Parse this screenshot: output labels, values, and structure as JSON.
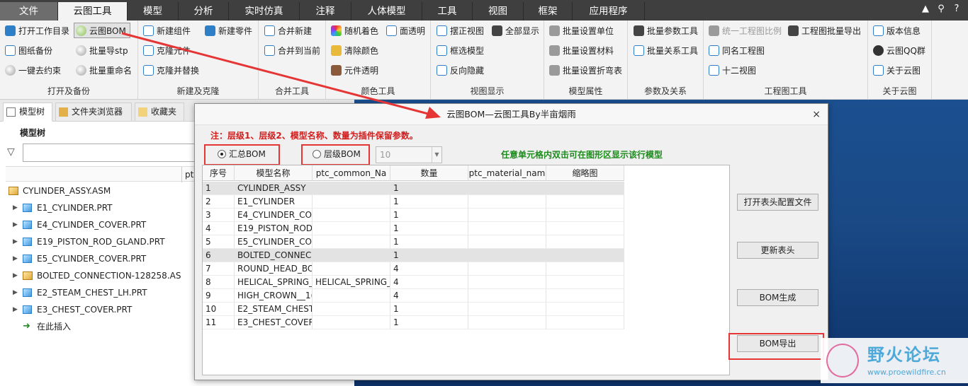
{
  "menu": {
    "tabs": [
      "文件",
      "云图工具",
      "模型",
      "分析",
      "实时仿真",
      "注释",
      "人体模型",
      "工具",
      "视图",
      "框架",
      "应用程序"
    ],
    "active": "云图工具",
    "right_icons": [
      "expand-up-icon",
      "search-icon",
      "help-icon"
    ]
  },
  "ribbon": {
    "groups": [
      {
        "title": "打开及备份",
        "items": [
          "打开工作目录",
          "云图BOM",
          "图纸备份",
          "批量导stp",
          "一键去约束",
          "批量重命名"
        ]
      },
      {
        "title": "新建及克隆",
        "items": [
          "新建组件",
          "新建零件",
          "克隆元件",
          "克隆并替换"
        ]
      },
      {
        "title": "合并工具",
        "items": [
          "合并新建",
          "合并到当前"
        ]
      },
      {
        "title": "颜色工具",
        "items": [
          "随机着色",
          "面透明",
          "清除颜色",
          "元件透明"
        ]
      },
      {
        "title": "视图显示",
        "items": [
          "摆正视图",
          "全部显示",
          "框选模型",
          "反向隐藏"
        ]
      },
      {
        "title": "模型属性",
        "items": [
          "批量设置单位",
          "批量设置材料",
          "批量设置折弯表"
        ]
      },
      {
        "title": "参数及关系",
        "items": [
          "批量参数工具",
          "批量关系工具"
        ]
      },
      {
        "title": "工程图工具",
        "items": [
          "统一工程图比例",
          "工程图批量导出",
          "同名工程图",
          "十二视图"
        ]
      },
      {
        "title": "关于云图",
        "items": [
          "版本信息",
          "云图QQ群",
          "关于云图"
        ]
      }
    ]
  },
  "left_panel": {
    "tabs": [
      "模型树",
      "文件夹浏览器",
      "收藏夹"
    ],
    "heading": "模型树",
    "column": "ptc",
    "tree": [
      {
        "label": "CYLINDER_ASSY.ASM",
        "type": "asm",
        "root": true
      },
      {
        "label": "E1_CYLINDER.PRT",
        "type": "prt"
      },
      {
        "label": "E4_CYLINDER_COVER.PRT",
        "type": "prt"
      },
      {
        "label": "E19_PISTON_ROD_GLAND.PRT",
        "type": "prt"
      },
      {
        "label": "E5_CYLINDER_COVER.PRT",
        "type": "prt"
      },
      {
        "label": "BOLTED_CONNECTION-128258.AS",
        "type": "asm"
      },
      {
        "label": "E2_STEAM_CHEST_LH.PRT",
        "type": "prt"
      },
      {
        "label": "E3_CHEST_COVER.PRT",
        "type": "prt"
      },
      {
        "label": "在此插入",
        "type": "insert"
      }
    ]
  },
  "dialog": {
    "title": "云图BOM—云图工具By半亩烟雨",
    "close": "×",
    "note": "注：层级1、层级2、模型名称、数量为插件保留参数。",
    "radio_summary": "汇总BOM",
    "radio_level": "层级BOM",
    "level_value": "10",
    "hint": "任意单元格内双击可在图形区显示该行模型",
    "columns": [
      "序号",
      "模型名称",
      "ptc_common_Na",
      "数量",
      "ptc_material_nam",
      "缩略图"
    ],
    "rows": [
      [
        "1",
        "CYLINDER_ASSY",
        "",
        "1",
        "",
        ""
      ],
      [
        "2",
        "E1_CYLINDER",
        "",
        "1",
        "",
        ""
      ],
      [
        "3",
        "E4_CYLINDER_COV",
        "",
        "1",
        "",
        ""
      ],
      [
        "4",
        "E19_PISTON_ROD",
        "",
        "1",
        "",
        ""
      ],
      [
        "5",
        "E5_CYLINDER_COV",
        "",
        "1",
        "",
        ""
      ],
      [
        "6",
        "BOLTED_CONNEC",
        "",
        "1",
        "",
        ""
      ],
      [
        "7",
        "ROUND_HEAD_BO",
        "",
        "4",
        "",
        ""
      ],
      [
        "8",
        "HELICAL_SPRING_",
        "HELICAL_SPRING_",
        "4",
        "",
        ""
      ],
      [
        "9",
        "HIGH_CROWN__1(",
        "",
        "4",
        "",
        ""
      ],
      [
        "10",
        "E2_STEAM_CHEST",
        "",
        "1",
        "",
        ""
      ],
      [
        "11",
        "E3_CHEST_COVER",
        "",
        "1",
        "",
        ""
      ]
    ],
    "selected_rows": [
      0,
      5
    ],
    "buttons": [
      "打开表头配置文件",
      "更新表头",
      "BOM生成",
      "BOM导出"
    ]
  },
  "watermark": {
    "title": "野火论坛",
    "url": "www.proewildfire.cn"
  },
  "colors": {
    "menubar": "#3f3f3f",
    "annotation_red": "#e53535",
    "note_red": "#d31d1d",
    "hint_green": "#1c8c1c",
    "graphics_blue": "#1b4f8f"
  }
}
